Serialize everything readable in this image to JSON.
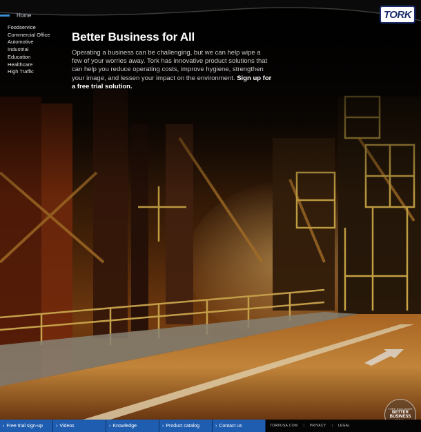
{
  "brand": {
    "logo_text": "TORK"
  },
  "nav": {
    "home_label": "Home",
    "items": [
      {
        "label": "Foodservice"
      },
      {
        "label": "Commercial Office"
      },
      {
        "label": "Automotive"
      },
      {
        "label": "Industrial"
      },
      {
        "label": "Education"
      },
      {
        "label": "Healthcare"
      },
      {
        "label": "High Traffic"
      }
    ]
  },
  "hero": {
    "title": "Better Business for All",
    "body": "Operating a business can be challenging, but we can help wipe a few of your worries away. Tork has innovative product solutions that can help you reduce operating costs, improve hygiene, strengthen your image, and lessen your impact on the environment.",
    "cta": "Sign up for a free trial solution."
  },
  "badge": {
    "top": "TORK EXCLUSIVE",
    "main": "BETTER BUSINESS",
    "sub": "FOR ALL"
  },
  "footer": {
    "tabs": [
      {
        "label": "Free trial sign-up"
      },
      {
        "label": "Videos"
      },
      {
        "label": "Knowledge"
      },
      {
        "label": "Product catalog"
      },
      {
        "label": "Contact us"
      }
    ],
    "links": [
      {
        "label": "TORKUSA.COM"
      },
      {
        "label": "PRIVACY"
      },
      {
        "label": "LEGAL"
      }
    ]
  },
  "colors": {
    "accent": "#1f5db0",
    "nav_bar": "#3a8fd8",
    "logo_blue": "#1b2d6b",
    "scaffold": "#d9b24a"
  }
}
